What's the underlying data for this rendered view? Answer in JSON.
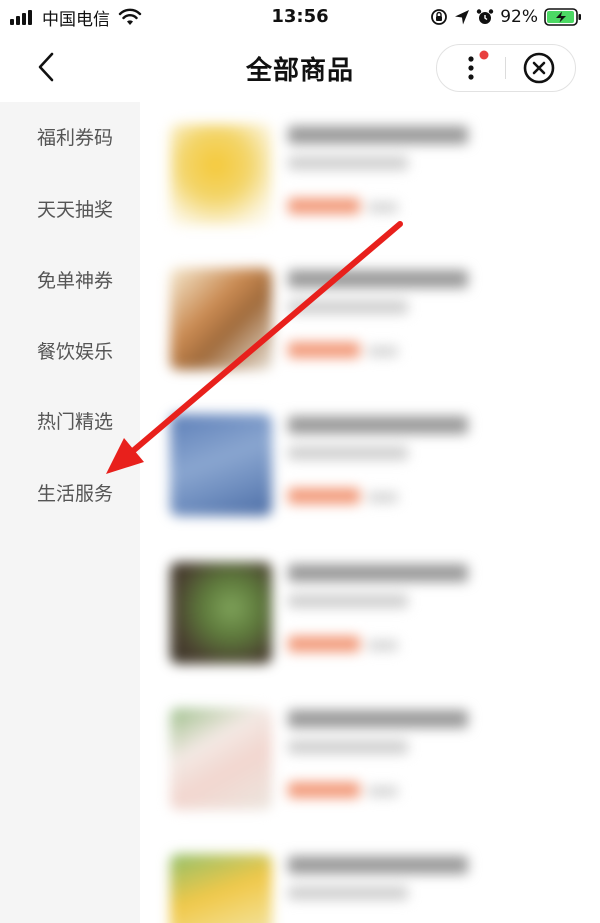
{
  "status_bar": {
    "carrier": "中国电信",
    "time": "13:56",
    "battery_percent": "92%",
    "icons": [
      "signal-icon",
      "wifi-icon",
      "orientation-lock-icon",
      "location-icon",
      "alarm-icon",
      "battery-charging-icon"
    ]
  },
  "nav": {
    "title": "全部商品",
    "back_icon": "chevron-left-icon",
    "more_icon": "more-vertical-icon",
    "close_icon": "close-circle-icon",
    "notification_dot_color": "#e8403f"
  },
  "sidebar": {
    "items": [
      {
        "label": "福利券码"
      },
      {
        "label": "天天抽奖"
      },
      {
        "label": "免单神券"
      },
      {
        "label": "餐饮娱乐"
      },
      {
        "label": "热门精选"
      },
      {
        "label": "生活服务"
      }
    ]
  },
  "annotation": {
    "arrow_color": "#e8201c",
    "points_to": "生活服务"
  },
  "colors": {
    "price_accent": "#f26b3a",
    "sidebar_bg": "#f5f5f5"
  }
}
